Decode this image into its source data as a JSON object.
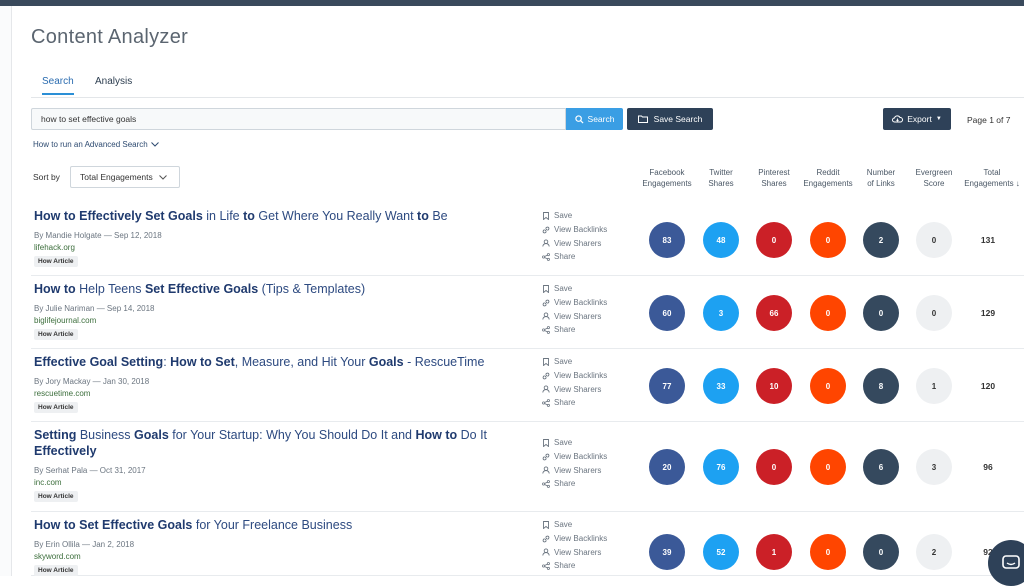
{
  "app": {
    "title": "Content Analyzer"
  },
  "tabs": [
    {
      "label": "Search",
      "active": true
    },
    {
      "label": "Analysis",
      "active": false
    }
  ],
  "search": {
    "value": "how to set effective goals",
    "button_label": "Search"
  },
  "save_search_label": "Save Search",
  "export_label": "Export",
  "pagination": {
    "text": "Page 1 of 7"
  },
  "advanced_search_link": "How to run an Advanced Search",
  "sort": {
    "label": "Sort by",
    "value": "Total Engagements"
  },
  "columns": [
    {
      "line1": "Facebook",
      "line2": "Engagements"
    },
    {
      "line1": "Twitter",
      "line2": "Shares"
    },
    {
      "line1": "Pinterest",
      "line2": "Shares"
    },
    {
      "line1": "Reddit",
      "line2": "Engagements"
    },
    {
      "line1": "Number",
      "line2": "of Links"
    },
    {
      "line1": "Evergreen",
      "line2": "Score"
    },
    {
      "line1": "Total",
      "line2": "Engagements ↓"
    }
  ],
  "action_labels": {
    "save": "Save",
    "backlinks": "View Backlinks",
    "sharers": "View Sharers",
    "share": "Share"
  },
  "results": [
    {
      "title_parts": [
        [
          "How to Effectively Set Goals",
          true
        ],
        [
          " in Life ",
          false
        ],
        [
          "to",
          true
        ],
        [
          " Get Where You Really Want ",
          false
        ],
        [
          "to",
          true
        ],
        [
          " Be",
          false
        ]
      ],
      "byline": "By Mandie Holgate — Sep 12, 2018",
      "domain": "lifehack.org",
      "badge": "How Article",
      "facebook": "83",
      "twitter": "48",
      "pinterest": "0",
      "reddit": "0",
      "links": "2",
      "evergreen": "0",
      "total": "131"
    },
    {
      "title_parts": [
        [
          "How to",
          true
        ],
        [
          " Help Teens ",
          false
        ],
        [
          "Set Effective Goals",
          true
        ],
        [
          " (Tips & Templates)",
          false
        ]
      ],
      "byline": "By Julie Nariman — Sep 14, 2018",
      "domain": "biglifejournal.com",
      "badge": "How Article",
      "facebook": "60",
      "twitter": "3",
      "pinterest": "66",
      "reddit": "0",
      "links": "0",
      "evergreen": "0",
      "total": "129"
    },
    {
      "title_parts": [
        [
          "Effective Goal Setting",
          true
        ],
        [
          ": ",
          false
        ],
        [
          "How to Set",
          true
        ],
        [
          ", Measure, and Hit Your ",
          false
        ],
        [
          "Goals",
          true
        ],
        [
          " - RescueTime",
          false
        ]
      ],
      "byline": "By Jory Mackay — Jan 30, 2018",
      "domain": "rescuetime.com",
      "badge": "How Article",
      "facebook": "77",
      "twitter": "33",
      "pinterest": "10",
      "reddit": "0",
      "links": "8",
      "evergreen": "1",
      "total": "120"
    },
    {
      "title_parts": [
        [
          "Setting",
          true
        ],
        [
          " Business ",
          false
        ],
        [
          "Goals",
          true
        ],
        [
          " for Your Startup: Why You Should Do It and ",
          false
        ],
        [
          "How to",
          true
        ],
        [
          " Do It ",
          false
        ],
        [
          "Effectively",
          true
        ]
      ],
      "byline": "By Serhat Pala — Oct 31, 2017",
      "domain": "inc.com",
      "badge": "How Article",
      "facebook": "20",
      "twitter": "76",
      "pinterest": "0",
      "reddit": "0",
      "links": "6",
      "evergreen": "3",
      "total": "96"
    },
    {
      "title_parts": [
        [
          "How to Set Effective Goals",
          true
        ],
        [
          " for Your Freelance Business",
          false
        ]
      ],
      "byline": "By Erin Ollila — Jan 2, 2018",
      "domain": "skyword.com",
      "badge": "How Article",
      "facebook": "39",
      "twitter": "52",
      "pinterest": "1",
      "reddit": "0",
      "links": "0",
      "evergreen": "2",
      "total": "92"
    }
  ],
  "colors": {
    "facebook": "#3b5998",
    "twitter": "#1da1f2",
    "pinterest": "#cb2027",
    "reddit": "#ff4500",
    "links": "#35495e",
    "evergreen": "#eef0f2",
    "primary_button": "#3a9ee4",
    "dark_button": "#2e4158"
  }
}
